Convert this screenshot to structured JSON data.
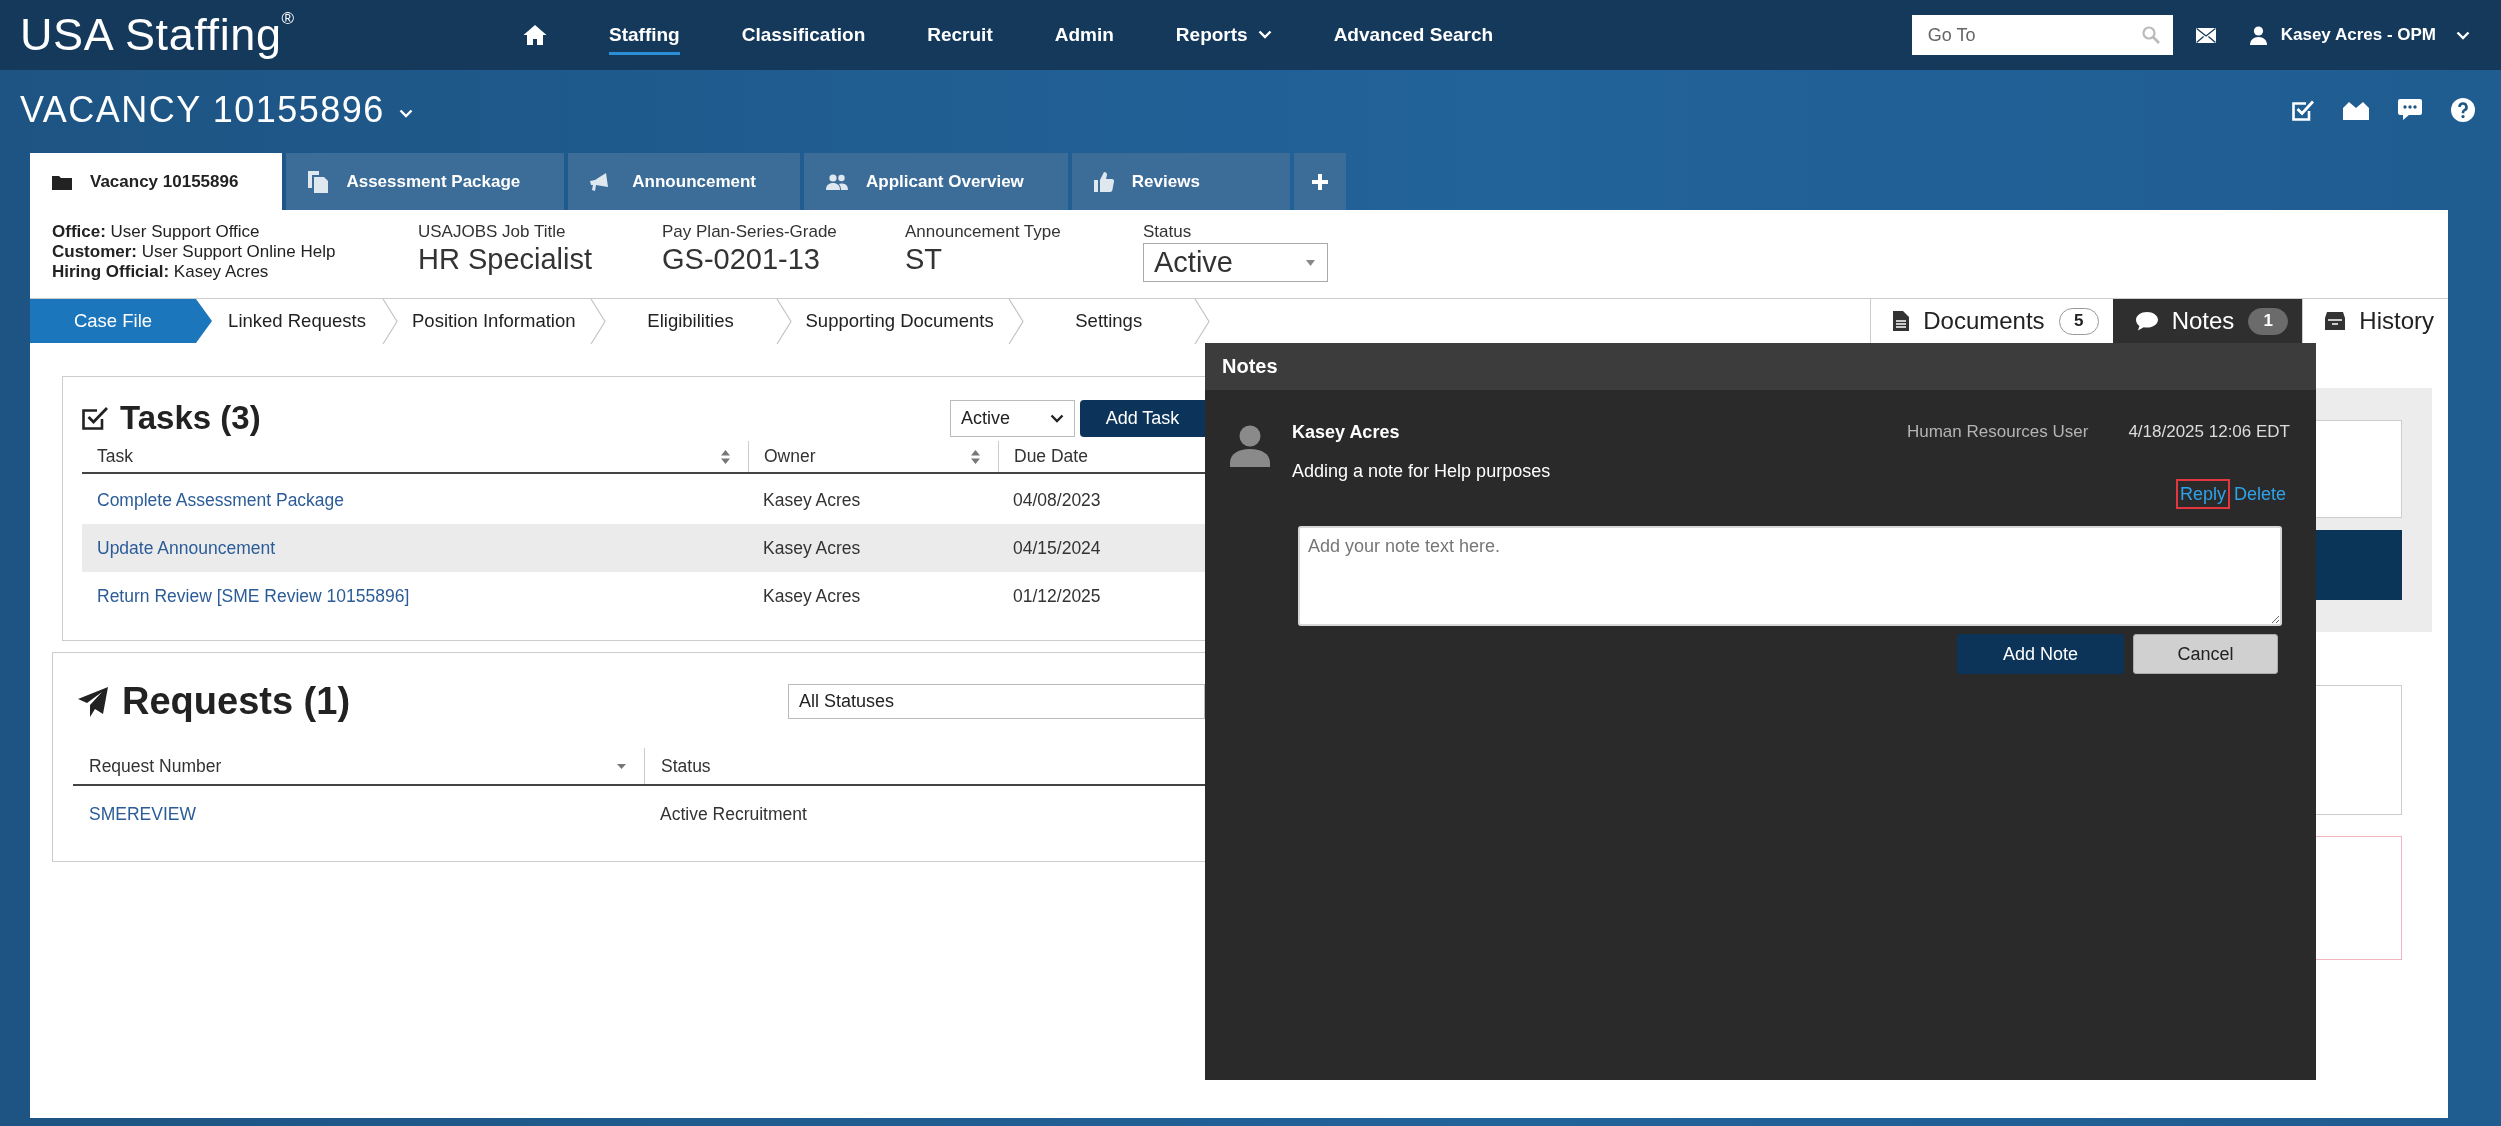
{
  "top_nav": {
    "logo": "USA Staffing$^{®}$",
    "items": [
      {
        "label": "Staffing",
        "selected": true,
        "dropdown": false
      },
      {
        "label": "Classification",
        "selected": false,
        "dropdown": false
      },
      {
        "label": "Recruit",
        "selected": false,
        "dropdown": false
      },
      {
        "label": "Admin",
        "selected": false,
        "dropdown": false
      },
      {
        "label": "Reports",
        "selected": false,
        "dropdown": true
      },
      {
        "label": "Advanced Search",
        "selected": false,
        "dropdown": false
      }
    ],
    "search": {
      "placeholder": "Go To"
    },
    "user": {
      "name": "Kasey Acres - OPM"
    }
  },
  "vacancy": {
    "title": "VACANCY 10155896"
  },
  "tabs": [
    {
      "label": "Vacancy 10155896",
      "selected": true
    },
    {
      "label": "Assessment Package",
      "selected": false
    },
    {
      "label": "Announcement",
      "selected": false
    },
    {
      "label": "Applicant Overview",
      "selected": false
    },
    {
      "label": "Reviews",
      "selected": false
    }
  ],
  "summary": {
    "contacts": [
      "**Office:** User Support Office",
      "**Customer:** User Support Online Help",
      "**Hiring Official:** Kasey Acres"
    ],
    "fields": [
      {
        "label": "USAJOBS Job Title",
        "value": "HR Specialist"
      },
      {
        "label": "Pay Plan-Series-Grade",
        "value": "GS-0201-13"
      },
      {
        "label": "Announcement Type",
        "value": "ST"
      }
    ],
    "status": {
      "label": "Status",
      "value": "Active"
    }
  },
  "steps": [
    {
      "label": "Case File",
      "selected": true
    },
    {
      "label": "Linked Requests",
      "selected": false
    },
    {
      "label": "Position Information",
      "selected": false
    },
    {
      "label": "Eligibilities",
      "selected": false
    },
    {
      "label": "Supporting Documents",
      "selected": false
    },
    {
      "label": "Settings",
      "selected": false
    }
  ],
  "side_tabs": [
    {
      "label": "Documents",
      "count": "5",
      "selected": false
    },
    {
      "label": "Notes",
      "count": "1",
      "selected": true
    },
    {
      "label": "History",
      "selected": false
    }
  ],
  "tasks": {
    "title": "Tasks (3)",
    "filter": "Active",
    "add_button": "Add Task",
    "columns": [
      {
        "label": "Task",
        "sortable": true
      },
      {
        "label": "Owner",
        "sortable": true
      },
      {
        "label": "Due Date",
        "sortable": false
      }
    ],
    "rows": [
      {
        "task": "Complete Assessment Package",
        "owner": "Kasey Acres",
        "due_date": "04/08/2023",
        "highlighted": false
      },
      {
        "task": "Update Announcement",
        "owner": "Kasey Acres",
        "due_date": "04/15/2024",
        "highlighted": true
      },
      {
        "task": "Return Review [SME Review 10155896]",
        "owner": "Kasey Acres",
        "due_date": "01/12/2025",
        "highlighted": false
      }
    ]
  },
  "requests": {
    "title": "Requests (1)",
    "filter": "All Statuses",
    "columns": [
      {
        "label": "Request Number",
        "sortable": true
      },
      {
        "label": "Status",
        "sortable": false
      }
    ],
    "rows": [
      {
        "number": "SMEREVIEW",
        "status": "Active Recruitment",
        "highlighted": false
      }
    ]
  },
  "notes_panel": {
    "title": "Notes",
    "notes": [
      {
        "author": "Kasey Acres",
        "role": "Human Resources User",
        "time": "4/18/2025 12:06 EDT",
        "text": "Adding a note for Help purposes",
        "actions": [
          {
            "label": "Reply",
            "highlighted": true
          },
          {
            "label": "Delete",
            "highlighted": false
          }
        ]
      }
    ],
    "input": {
      "placeholder": "Add your note text here."
    },
    "buttons": [
      {
        "label": "Add Note",
        "kind": "primary"
      },
      {
        "label": "Cancel",
        "kind": "secondary"
      }
    ]
  }
}
